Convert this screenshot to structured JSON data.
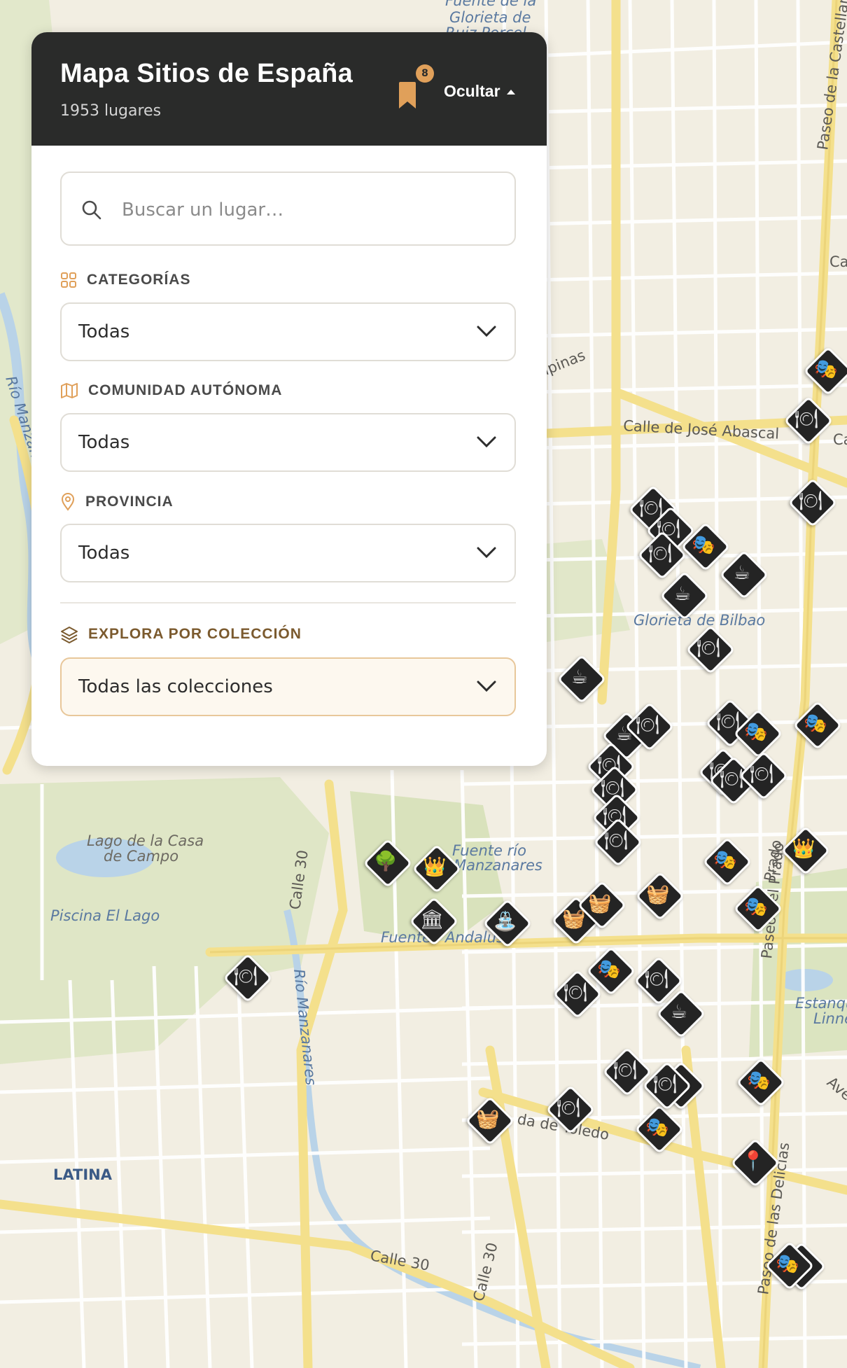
{
  "panel": {
    "title": "Mapa Sitios de España",
    "subtitle": "1953 lugares",
    "saved_count": "8",
    "toggle_label": "Ocultar",
    "search_placeholder": "Buscar un lugar…",
    "filters": {
      "categories": {
        "label": "CATEGORÍAS",
        "value": "Todas"
      },
      "community": {
        "label": "COMUNIDAD AUTÓNOMA",
        "value": "Todas"
      },
      "province": {
        "label": "PROVINCIA",
        "value": "Todas"
      },
      "collection": {
        "label": "EXPLORA POR COLECCIÓN",
        "value": "Todas las colecciones"
      }
    }
  },
  "map": {
    "labels": {
      "glorieta_top": "Fuente de la",
      "glorieta_top2": "Glorieta de",
      "glorieta_top3": "Ruiz Porcel",
      "castellana": "Paseo de la Castellana",
      "ca_right": "Ca",
      "filipinas": "ipinas",
      "abascal": "Calle de José Abascal",
      "ca_right2": "Ca",
      "rio_manz": "Río Manzanares",
      "glorieta_bilbao": "Glorieta de Bilbao",
      "lago": "Lago de la Casa",
      "lago2": "de Campo",
      "piscina": "Piscina El Lago",
      "calle30": "Calle 30",
      "fuente_rio": "Fuente río",
      "manzanares": "Manzanares",
      "fuen": "Fuente",
      "dalus": "Andalusí",
      "rio_manzanares2": "Río Manzanares",
      "prado": "Prado",
      "paseo_prado": "Paseo del Prado",
      "estanque": "Estanque",
      "linne": "Linneo",
      "ave": "Ave",
      "toledo": "da de Toledo",
      "latina": "LATINA",
      "calle30_bottom": "Calle 30",
      "calle30_bottom2": "Calle 30",
      "delicias": "Paseo de las Delicias"
    },
    "colors": {
      "land": "#f2eee2",
      "park": "#dfe6c6",
      "water": "#b9d3e8",
      "major_road": "#f4e08c",
      "minor_road": "#ffffff",
      "marker": "#242424",
      "accent": "#e0a05a"
    }
  },
  "markers": [
    {
      "icon": "theater-icon",
      "glyph": "🎭"
    },
    {
      "icon": "restaurant-icon",
      "glyph": "🍽"
    },
    {
      "icon": "restaurant-icon",
      "glyph": "🍽"
    },
    {
      "icon": "restaurant-icon",
      "glyph": "🍽"
    },
    {
      "icon": "restaurant-icon",
      "glyph": "🍽"
    },
    {
      "icon": "theater-icon",
      "glyph": "🎭"
    },
    {
      "icon": "coffee-icon",
      "glyph": "☕"
    },
    {
      "icon": "coffee-icon",
      "glyph": "☕"
    },
    {
      "icon": "restaurant-icon",
      "glyph": "🍽"
    },
    {
      "icon": "restaurant-icon",
      "glyph": "🍽"
    },
    {
      "icon": "coffee-icon",
      "glyph": "☕"
    },
    {
      "icon": "coffee-icon",
      "glyph": "☕"
    },
    {
      "icon": "restaurant-icon",
      "glyph": "🍽"
    },
    {
      "icon": "restaurant-icon",
      "glyph": "🍽"
    },
    {
      "icon": "restaurant-icon",
      "glyph": "🍽"
    },
    {
      "icon": "restaurant-icon",
      "glyph": "🍽"
    },
    {
      "icon": "restaurant-icon",
      "glyph": "🍽"
    },
    {
      "icon": "restaurant-icon",
      "glyph": "🍽"
    },
    {
      "icon": "theater-icon",
      "glyph": "🎭"
    },
    {
      "icon": "restaurant-icon",
      "glyph": "🍽"
    },
    {
      "icon": "restaurant-icon",
      "glyph": "🍽"
    },
    {
      "icon": "restaurant-icon",
      "glyph": "🍽"
    },
    {
      "icon": "theater-icon",
      "glyph": "🎭"
    },
    {
      "icon": "crown-icon",
      "glyph": "👑"
    },
    {
      "icon": "theater-icon",
      "glyph": "🎭"
    },
    {
      "icon": "theater-icon",
      "glyph": "🎭"
    },
    {
      "icon": "tree-icon",
      "glyph": "🌳"
    },
    {
      "icon": "crown-icon",
      "glyph": "👑"
    },
    {
      "icon": "palace-icon",
      "glyph": "🏛"
    },
    {
      "icon": "fountain-icon",
      "glyph": "⛲"
    },
    {
      "icon": "basket-icon",
      "glyph": "🧺"
    },
    {
      "icon": "basket-icon",
      "glyph": "🧺"
    },
    {
      "icon": "basket-icon",
      "glyph": "🧺"
    },
    {
      "icon": "restaurant-icon",
      "glyph": "🍽"
    },
    {
      "icon": "theater-icon",
      "glyph": "🎭"
    },
    {
      "icon": "restaurant-icon",
      "glyph": "🍽"
    },
    {
      "icon": "restaurant-icon",
      "glyph": "🍽"
    },
    {
      "icon": "coffee-icon",
      "glyph": "☕"
    },
    {
      "icon": "restaurant-icon",
      "glyph": "🍽"
    },
    {
      "icon": "coffee-icon",
      "glyph": "☕"
    },
    {
      "icon": "restaurant-icon",
      "glyph": "🍽"
    },
    {
      "icon": "theater-icon",
      "glyph": "🎭"
    },
    {
      "icon": "theater-icon",
      "glyph": "🎭"
    },
    {
      "icon": "basket-icon",
      "glyph": "🧺"
    },
    {
      "icon": "restaurant-icon",
      "glyph": "🍽"
    },
    {
      "icon": "theater-icon",
      "glyph": "🎭"
    },
    {
      "icon": "pin-icon",
      "glyph": "📍"
    },
    {
      "icon": "theater-icon",
      "glyph": "🎭"
    }
  ]
}
